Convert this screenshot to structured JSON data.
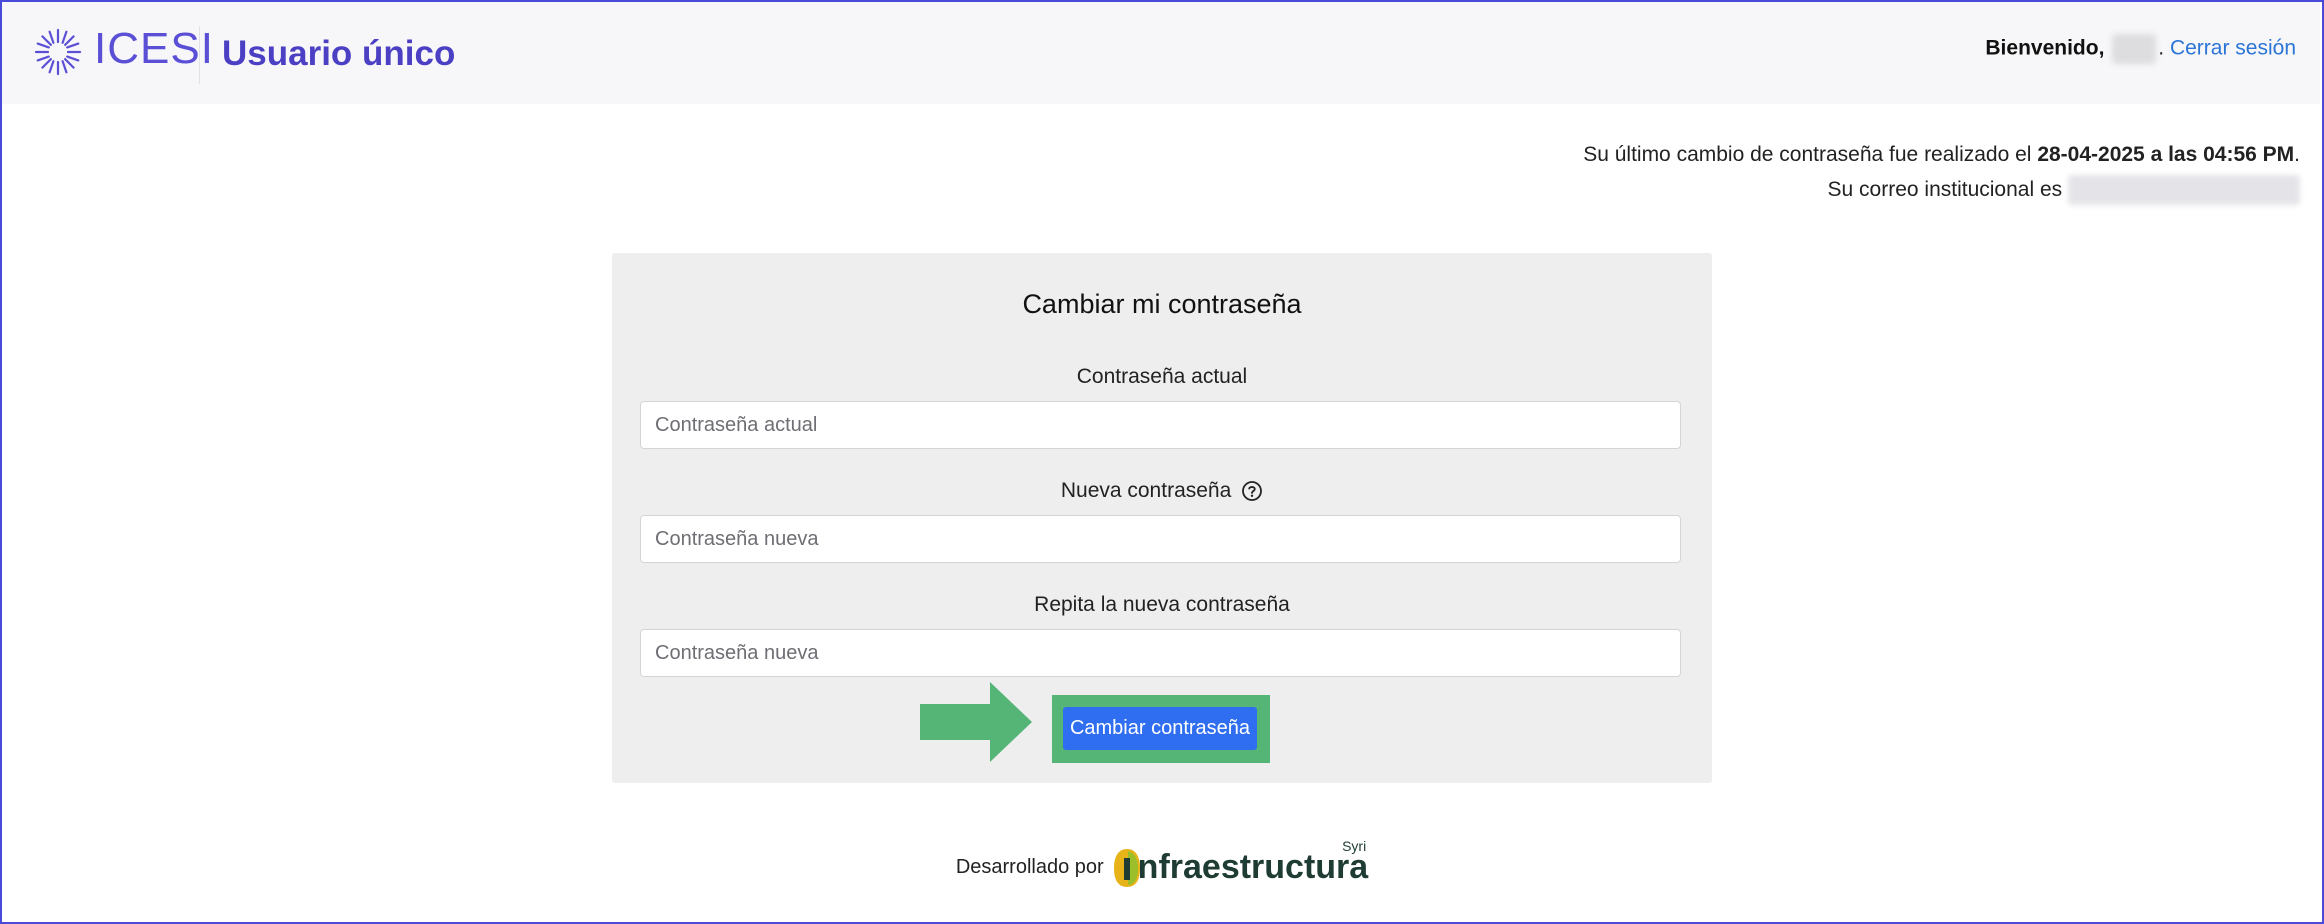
{
  "header": {
    "logo_text": "ICESI",
    "app_title": "Usuario único",
    "welcome_label": "Bienvenido,",
    "welcome_suffix": ".",
    "logout_label": "Cerrar sesión"
  },
  "info": {
    "last_change_prefix": "Su último cambio de contraseña fue realizado el",
    "last_change_date": "28-04-2025 a las 04:56 PM",
    "last_change_suffix": ".",
    "email_label": "Su correo institucional es"
  },
  "form": {
    "title": "Cambiar mi contraseña",
    "current_label": "Contraseña actual",
    "current_placeholder": "Contraseña actual",
    "new_label": "Nueva contraseña",
    "new_placeholder": "Contraseña nueva",
    "repeat_label": "Repita la nueva contraseña",
    "repeat_placeholder": "Contraseña nueva",
    "submit_label": "Cambiar contraseña"
  },
  "footer": {
    "developed_by": "Desarrollado por",
    "brand": "nfraestructura",
    "brand_tag": "Syri"
  },
  "colors": {
    "brand_purple": "#4b3fc4",
    "link_blue": "#2a75d6",
    "button_blue": "#2f6ef0",
    "highlight_green": "#54b576"
  },
  "icons": [
    "icesi-logo-icon",
    "help-circle-icon",
    "arrow-right-icon",
    "infraestructura-logo-icon"
  ]
}
